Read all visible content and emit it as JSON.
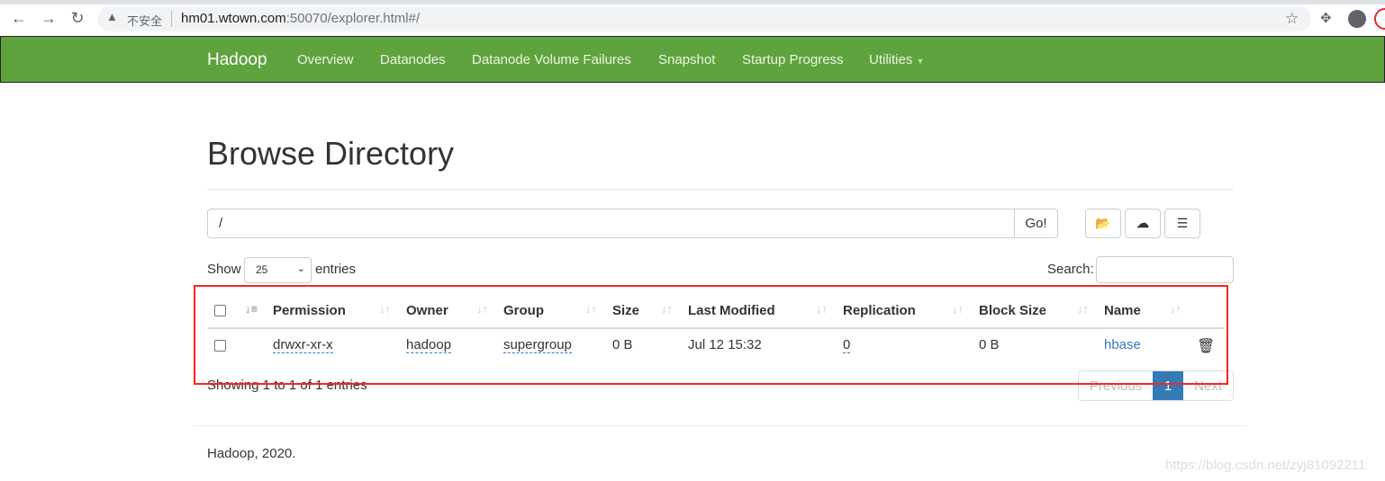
{
  "browser": {
    "url_host": "hm01.wtown.com",
    "url_rest": ":50070/explorer.html#/",
    "security_label": "不安全"
  },
  "navbar": {
    "brand": "Hadoop",
    "items": [
      "Overview",
      "Datanodes",
      "Datanode Volume Failures",
      "Snapshot",
      "Startup Progress",
      "Utilities"
    ]
  },
  "page": {
    "title": "Browse Directory",
    "path": "/",
    "go_label": "Go!",
    "show_label": "Show",
    "entries_value": "25",
    "entries_label": "entries",
    "search_label": "Search:",
    "columns": [
      "Permission",
      "Owner",
      "Group",
      "Size",
      "Last Modified",
      "Replication",
      "Block Size",
      "Name"
    ],
    "rows": [
      {
        "permission": "drwxr-xr-x",
        "owner": "hadoop",
        "group": "supergroup",
        "size": "0 B",
        "last_modified": "Jul 12 15:32",
        "replication": "0",
        "block_size": "0 B",
        "name": "hbase"
      }
    ],
    "info": "Showing 1 to 1 of 1 entries",
    "pagination": {
      "previous": "Previous",
      "current": "1",
      "next": "Next"
    }
  },
  "footer": "Hadoop, 2020.",
  "watermark": "https://blog.csdn.net/zyj81092211",
  "colors": {
    "navbar": "#5fa33e",
    "link": "#337ab7",
    "highlight": "#f22222"
  }
}
